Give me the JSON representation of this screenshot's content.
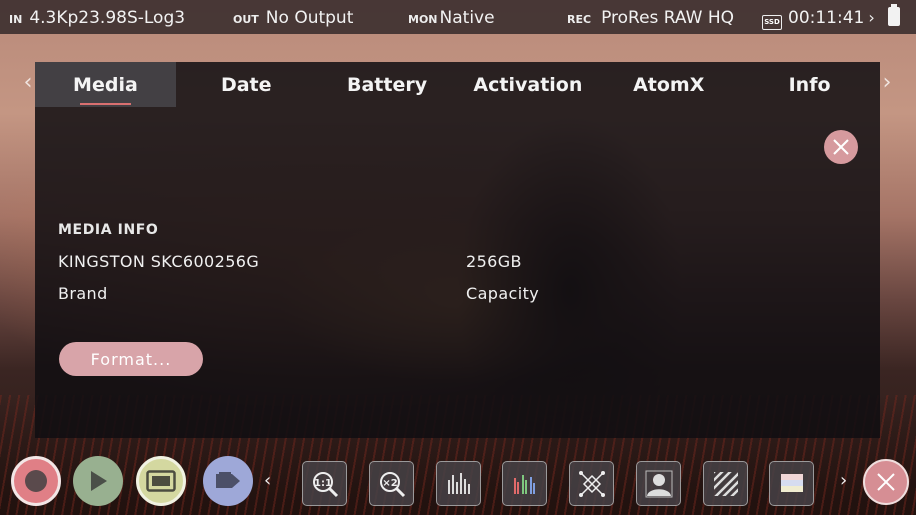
{
  "status_bar": {
    "in_label": "IN",
    "in_value": "4.3Kp23.98S-Log3",
    "out_label": "OUT",
    "out_value": "No Output",
    "mon_label": "MON",
    "mon_value": "Native",
    "rec_label": "REC",
    "rec_value": "ProRes RAW HQ",
    "ssd_label": "SSD",
    "timecode": "00:11:41",
    "chevron": "›"
  },
  "tabs": [
    {
      "label": "Media",
      "active": true
    },
    {
      "label": "Date",
      "active": false
    },
    {
      "label": "Battery",
      "active": false
    },
    {
      "label": "Activation",
      "active": false
    },
    {
      "label": "AtomX",
      "active": false
    },
    {
      "label": "Info",
      "active": false
    }
  ],
  "tab_nav": {
    "left": "‹",
    "right": "›"
  },
  "media_info": {
    "section_title": "MEDIA INFO",
    "brand_value": "KINGSTON SKC600256G",
    "brand_label": "Brand",
    "capacity_value": "256GB",
    "capacity_label": "Capacity"
  },
  "format_button": {
    "label": "Format..."
  },
  "toolbar": {
    "left_arrow": "‹",
    "right_arrow": "›",
    "tools": [
      "zoom-1to1-icon",
      "zoom-x2-icon",
      "waveform-icon",
      "rgb-parade-icon",
      "focus-peaking-icon",
      "false-color-icon",
      "zebra-icon",
      "lut-icon"
    ]
  },
  "colors": {
    "accent_pink": "#d69a9e",
    "record_red": "#e07f86",
    "play_green": "#98b090",
    "monitor_yellow": "#d4d8a0",
    "tag_blue": "#9ea8d8",
    "tab_underline": "#d97070"
  }
}
